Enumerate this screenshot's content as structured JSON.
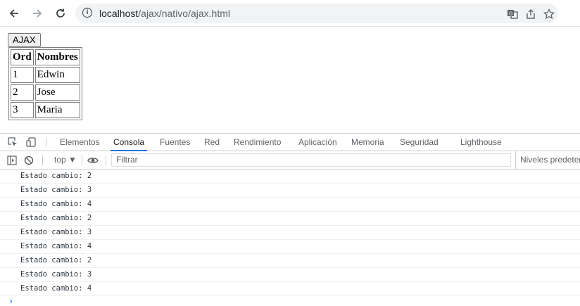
{
  "browser": {
    "url_host": "localhost",
    "url_path": "/ajax/nativo/ajax.html"
  },
  "page": {
    "button_label": "AJAX",
    "table": {
      "headers": [
        "Ord",
        "Nombres"
      ],
      "rows": [
        [
          "1",
          "Edwin"
        ],
        [
          "2",
          "Jose"
        ],
        [
          "3",
          "Maria"
        ]
      ]
    }
  },
  "devtools": {
    "tabs": [
      "Elementos",
      "Consola",
      "Fuentes",
      "Red",
      "Rendimiento",
      "Aplicación",
      "Memoria",
      "Seguridad",
      "Lighthouse"
    ],
    "active_tab": "Consola",
    "context": "top",
    "filter_placeholder": "Filtrar",
    "levels_label": "Niveles predeter",
    "console_logs": [
      "Estado cambio: 2",
      "Estado cambio: 3",
      "Estado cambio: 4",
      "Estado cambio: 2",
      "Estado cambio: 3",
      "Estado cambio: 4",
      "Estado cambio: 2",
      "Estado cambio: 3",
      "Estado cambio: 4"
    ]
  },
  "icons": {
    "accent": "#1a73e8"
  }
}
